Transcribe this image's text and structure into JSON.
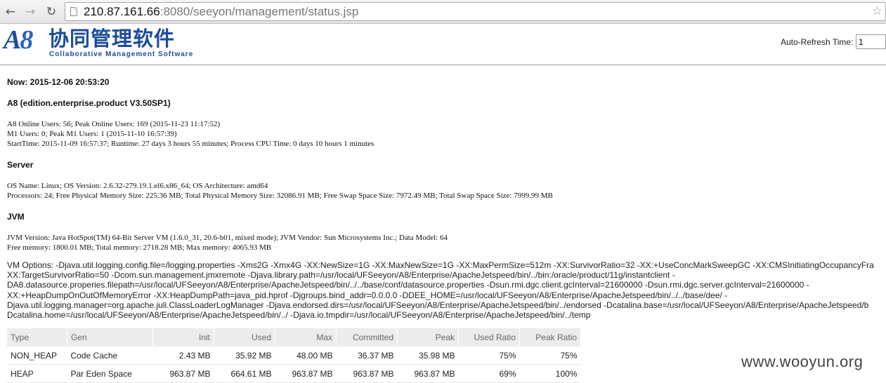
{
  "browser": {
    "url_host": "210.87.161.66",
    "url_rest": ":8080/seeyon/management/status.jsp",
    "icons": {
      "back": "back-arrow-icon",
      "forward": "forward-arrow-icon",
      "reload": "reload-icon",
      "page": "page-icon",
      "star": "star-icon"
    }
  },
  "header": {
    "logo_a": "A",
    "logo_8": "8",
    "logo_cn": "协同管理软件",
    "logo_en": "Collaborative Management Software",
    "refresh_label": "Auto-Refresh Time:",
    "refresh_value": "1"
  },
  "status": {
    "now": "Now: 2015-12-06 20:53:20",
    "edition": "A8 (edition.enterprise.product V3.50SP1)",
    "users": [
      "A8 Online Users: 56; Peak Online Users: 169 (2015-11-23 11:17:52)",
      "M1 Users: 0; Peak M1 Users: 1 (2015-11-10 16:57:39)",
      "StartTime: 2015-11-09 16:57:37; Runtime: 27 days 3 hours 55 minutes; Process CPU Time: 0 days 10 hours 1 minutes"
    ],
    "server_heading": "Server",
    "server": [
      "OS Name: Linux; OS Version: 2.6.32-279.19.1.el6.x86_64; OS Architecture: amd64",
      "Processors: 24; Free Physical Memory Size: 225.36 MB; Total Physical Memory Size: 32086.91 MB; Free Swap Space Size: 7972.49 MB; Total Swap Space Size: 7999.99 MB"
    ],
    "jvm_heading": "JVM",
    "jvm": [
      "JVM Version: Java HotSpot(TM) 64-Bit Server VM (1.6.0_31, 20.6-b01, mixed mode); JVM Vendor: Sun Microsystems Inc.; Data Model: 64",
      "Free memory: 1800.01 MB; Total memory: 2718.28 MB; Max memory: 4065.93 MB"
    ],
    "vm_options": [
      "VM Options: -Djava.util.logging.config.file=/logging.properties -Xms2G -Xmx4G -XX:NewSize=1G -XX:MaxNewSize=1G -XX:MaxPermSize=512m -XX:SurvivorRatio=32 -XX:+UseConcMarkSweepGC -XX:CMSInitiatingOccupancyFra",
      "XX:TargetSurvivorRatio=50 -Dcom.sun.management.jmxremote -Djava.library.path=/usr/local/UFSeeyon/A8/Enterprise/ApacheJetspeed/bin/../bin:/oracle/product/11g/instantclient -",
      "DA8.datasource.properies.filepath=/usr/local/UFSeeyon/A8/Enterprise/ApacheJetspeed/bin/../../base/conf/datasource.properties -Dsun.rmi.dgc.client.gcInterval=21600000 -Dsun.rmi.dgc.server.gcInterval=21600000 -",
      "XX:+HeapDumpOnOutOfMemoryError -XX:HeapDumpPath=java_pid.hprof -Djgroups.bind_addr=0.0.0.0 -DDEE_HOME=/usr/local/UFSeeyon/A8/Enterprise/ApacheJetspeed/bin/../../base/dee/ -",
      "Djava.util.logging.manager=org.apache.juli.ClassLoaderLogManager -Djava.endorsed.dirs=/usr/local/UFSeeyon/A8/Enterprise/ApacheJetspeed/bin/../endorsed -Dcatalina.base=/usr/local/UFSeeyon/A8/Enterprise/ApacheJetspeed/b",
      "Dcatalina.home=/usr/local/UFSeeyon/A8/Enterprise/ApacheJetspeed/bin/../ -Djava.io.tmpdir=/usr/local/UFSeeyon/A8/Enterprise/ApacheJetspeed/bin/../temp"
    ]
  },
  "memory_table": {
    "headers": [
      "Type",
      "Gen",
      "Init",
      "Used",
      "Max",
      "Committed",
      "Peak",
      "Used Ratio",
      "Peak Ratio"
    ],
    "rows": [
      [
        "NON_HEAP",
        "Code Cache",
        "2.43 MB",
        "35.92 MB",
        "48.00 MB",
        "36.37 MB",
        "35.98 MB",
        "75%",
        "75%"
      ],
      [
        "HEAP",
        "Par Eden Space",
        "963.87 MB",
        "664.61 MB",
        "963.87 MB",
        "963.87 MB",
        "963.87 MB",
        "69%",
        "100%"
      ]
    ]
  },
  "watermark": "www.wooyun.org"
}
